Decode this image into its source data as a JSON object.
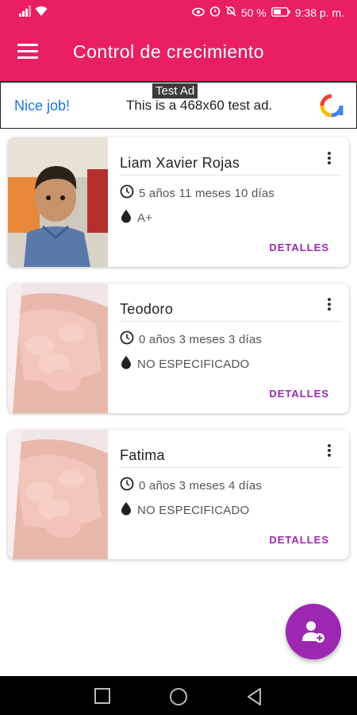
{
  "status_bar": {
    "battery_percent": "50 %",
    "time": "9:38 p. m."
  },
  "app_bar": {
    "title": "Control de crecimiento"
  },
  "ad": {
    "tag": "Test Ad",
    "left_text": "Nice job!",
    "center_text": "This is a 468x60 test ad."
  },
  "children": [
    {
      "name": "Liam Xavier Rojas",
      "age": "5 años 11 meses 10 días",
      "blood_type": "A+",
      "details_label": "DETALLES",
      "photo": "boy-photo"
    },
    {
      "name": "Teodoro",
      "age": "0 años 3 meses 3 días",
      "blood_type": "NO ESPECIFICADO",
      "details_label": "DETALLES",
      "photo": "baby-hand-photo"
    },
    {
      "name": "Fatima",
      "age": "0 años 3 meses 4 días",
      "blood_type": "NO ESPECIFICADO",
      "details_label": "DETALLES",
      "photo": "baby-hand-photo"
    }
  ],
  "colors": {
    "primary": "#e91e63",
    "accent": "#9c27b0",
    "link": "#1a73e8"
  }
}
